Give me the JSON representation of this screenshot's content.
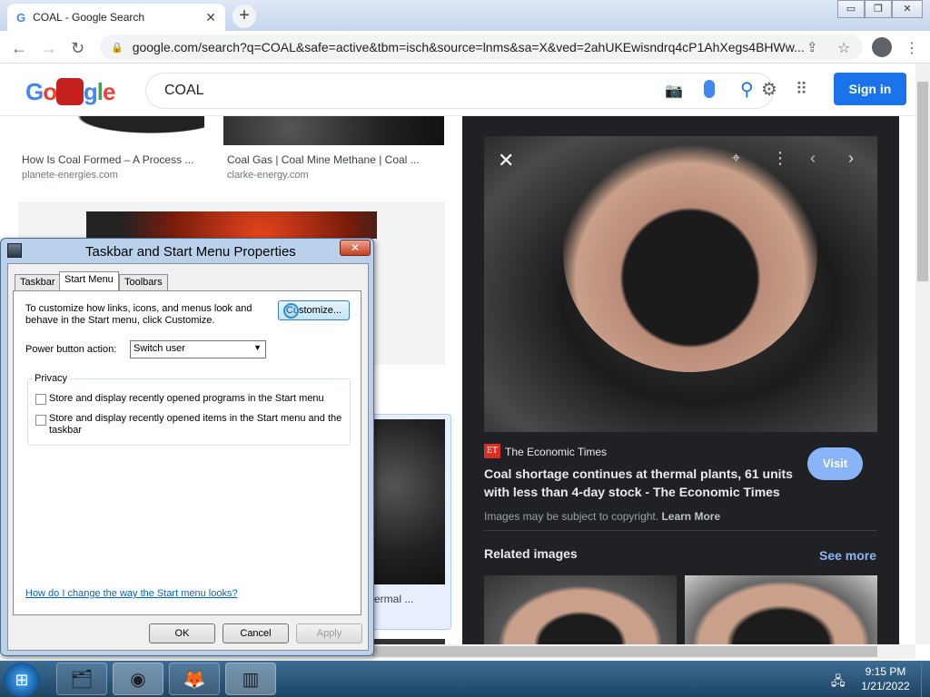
{
  "browser": {
    "tab_title": "COAL - Google Search",
    "url": "google.com/search?q=COAL&safe=active&tbm=isch&source=lnms&sa=X&ved=2ahUKEwisndrq4cP1AhXegs4BHWw..."
  },
  "google": {
    "search_value": "COAL",
    "sign_in": "Sign in"
  },
  "results": [
    {
      "caption": "How Is Coal Formed – A Process ...",
      "source": "planete-energies.com"
    },
    {
      "caption": "Coal Gas | Coal Mine Methane | Coal ...",
      "source": "clarke-energy.com"
    },
    {
      "caption": "ermal ..."
    }
  ],
  "panel": {
    "source_badge": "ET",
    "source": "The Economic Times",
    "title_line1": "Coal shortage continues at thermal plants, 61 units",
    "title_line2": "with less than 4-day stock - The Economic Times",
    "visit": "Visit",
    "copyright": "Images may be subject to copyright.",
    "learn_more": "Learn More",
    "related": "Related images",
    "see_more": "See more"
  },
  "dialog": {
    "title": "Taskbar and Start Menu Properties",
    "tabs": [
      "Taskbar",
      "Start Menu",
      "Toolbars"
    ],
    "description_line1": "To customize how links, icons, and menus look and",
    "description_line2": "behave in the Start menu, click Customize.",
    "customize": "Customize...",
    "power_label": "Power button action:",
    "power_value": "Switch user",
    "privacy_label": "Privacy",
    "privacy_opt1": "Store and display recently opened programs in the Start menu",
    "privacy_opt2_line1": "Store and display recently opened items in the Start menu and the",
    "privacy_opt2_line2": "taskbar",
    "help_link": "How do I change the way the Start menu looks?",
    "ok": "OK",
    "cancel": "Cancel",
    "apply": "Apply"
  },
  "taskbar": {
    "time": "9:15 PM",
    "date": "1/21/2022"
  },
  "colors": {
    "accent": "#1a73e8",
    "panel_bg": "#202124",
    "visit_bg": "#8ab4f8"
  }
}
